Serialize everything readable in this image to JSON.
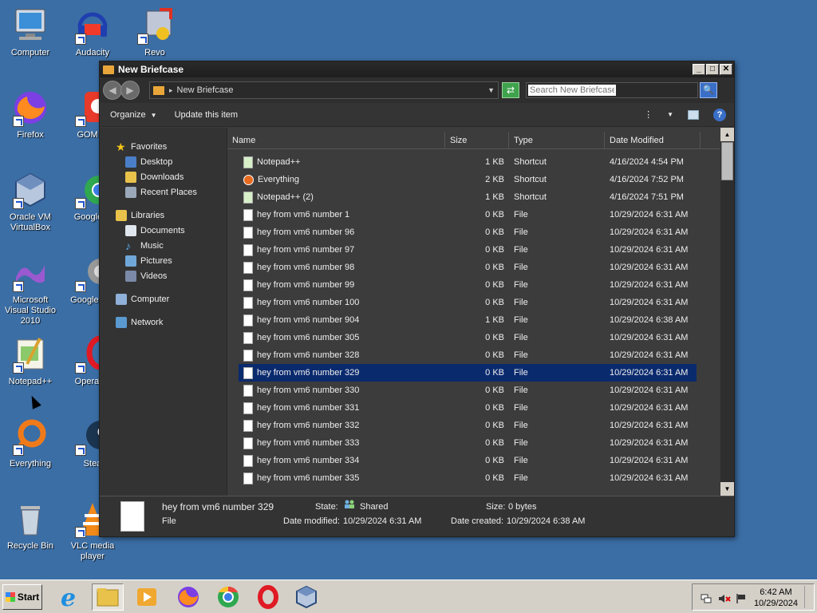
{
  "desktop": {
    "icons": [
      {
        "label": "Computer"
      },
      {
        "label": "Audacity"
      },
      {
        "label": "Revo"
      },
      {
        "label": "Firefox"
      },
      {
        "label": "GOM Pl"
      },
      {
        "label": "Oracle VM VirtualBox"
      },
      {
        "label": "Google C"
      },
      {
        "label": "Microsoft Visual Studio 2010"
      },
      {
        "label": "Google Pro"
      },
      {
        "label": "Notepad++"
      },
      {
        "label": "Opera Br"
      },
      {
        "label": "Everything"
      },
      {
        "label": "Stea"
      },
      {
        "label": "Recycle Bin"
      },
      {
        "label": "VLC media player"
      }
    ]
  },
  "window": {
    "title": "New Briefcase",
    "address": "New Briefcase",
    "search_placeholder": "Search New Briefcase",
    "toolbar": {
      "organize": "Organize",
      "update": "Update this item"
    },
    "nav": {
      "favorites": "Favorites",
      "desktop": "Desktop",
      "downloads": "Downloads",
      "recent": "Recent Places",
      "libraries": "Libraries",
      "documents": "Documents",
      "music": "Music",
      "pictures": "Pictures",
      "videos": "Videos",
      "computer": "Computer",
      "network": "Network"
    },
    "columns": {
      "name": "Name",
      "size": "Size",
      "type": "Type",
      "date": "Date Modified"
    },
    "files": [
      {
        "name": "Notepad++",
        "size": "1 KB",
        "type": "Shortcut",
        "date": "4/16/2024 4:54 PM"
      },
      {
        "name": "Everything",
        "size": "2 KB",
        "type": "Shortcut",
        "date": "4/16/2024 7:52 PM"
      },
      {
        "name": "Notepad++ (2)",
        "size": "1 KB",
        "type": "Shortcut",
        "date": "4/16/2024 7:51 PM"
      },
      {
        "name": "hey from vm6 number 1",
        "size": "0 KB",
        "type": "File",
        "date": "10/29/2024 6:31 AM"
      },
      {
        "name": "hey from vm6 number 96",
        "size": "0 KB",
        "type": "File",
        "date": "10/29/2024 6:31 AM"
      },
      {
        "name": "hey from vm6 number 97",
        "size": "0 KB",
        "type": "File",
        "date": "10/29/2024 6:31 AM"
      },
      {
        "name": "hey from vm6 number 98",
        "size": "0 KB",
        "type": "File",
        "date": "10/29/2024 6:31 AM"
      },
      {
        "name": "hey from vm6 number 99",
        "size": "0 KB",
        "type": "File",
        "date": "10/29/2024 6:31 AM"
      },
      {
        "name": "hey from vm6 number 100",
        "size": "0 KB",
        "type": "File",
        "date": "10/29/2024 6:31 AM"
      },
      {
        "name": "hey from vm6 number 904",
        "size": "1 KB",
        "type": "File",
        "date": "10/29/2024 6:38 AM"
      },
      {
        "name": "hey from vm6 number 305",
        "size": "0 KB",
        "type": "File",
        "date": "10/29/2024 6:31 AM"
      },
      {
        "name": "hey from vm6 number 328",
        "size": "0 KB",
        "type": "File",
        "date": "10/29/2024 6:31 AM"
      },
      {
        "name": "hey from vm6 number 329",
        "size": "0 KB",
        "type": "File",
        "date": "10/29/2024 6:31 AM"
      },
      {
        "name": "hey from vm6 number 330",
        "size": "0 KB",
        "type": "File",
        "date": "10/29/2024 6:31 AM"
      },
      {
        "name": "hey from vm6 number 331",
        "size": "0 KB",
        "type": "File",
        "date": "10/29/2024 6:31 AM"
      },
      {
        "name": "hey from vm6 number 332",
        "size": "0 KB",
        "type": "File",
        "date": "10/29/2024 6:31 AM"
      },
      {
        "name": "hey from vm6 number 333",
        "size": "0 KB",
        "type": "File",
        "date": "10/29/2024 6:31 AM"
      },
      {
        "name": "hey from vm6 number 334",
        "size": "0 KB",
        "type": "File",
        "date": "10/29/2024 6:31 AM"
      },
      {
        "name": "hey from vm6 number 335",
        "size": "0 KB",
        "type": "File",
        "date": "10/29/2024 6:31 AM"
      }
    ],
    "details": {
      "name": "hey from vm6 number 329",
      "kind": "File",
      "state_label": "State:",
      "state_value": "Shared",
      "size_label": "Size:",
      "size_value": "0 bytes",
      "modified_label": "Date modified:",
      "modified_value": "10/29/2024 6:31 AM",
      "created_label": "Date created:",
      "created_value": "10/29/2024 6:38 AM"
    }
  },
  "taskbar": {
    "start": "Start",
    "time": "6:42 AM",
    "date": "10/29/2024"
  },
  "colors": {
    "desktop": "#3b6ea5",
    "selection": "#0a2a6e",
    "folder": "#e8a63a"
  }
}
